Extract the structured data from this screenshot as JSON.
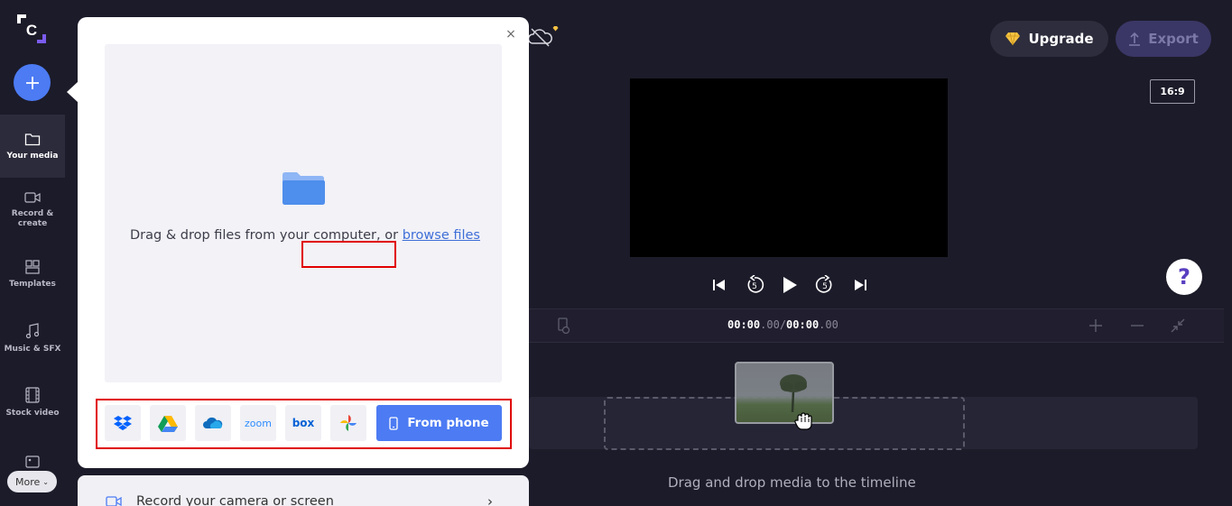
{
  "rail": {
    "items": [
      {
        "label": "Your media",
        "icon": "folder-icon"
      },
      {
        "label": "Record & create",
        "icon": "camera-icon"
      },
      {
        "label": "Templates",
        "icon": "templates-icon"
      },
      {
        "label": "Music & SFX",
        "icon": "music-icon"
      },
      {
        "label": "Stock video",
        "icon": "film-icon"
      }
    ],
    "more_label": "More"
  },
  "topbar": {
    "upgrade_label": "Upgrade",
    "export_label": "Export"
  },
  "preview": {
    "aspect_ratio": "16:9"
  },
  "timeline": {
    "current_time": "00:00",
    "current_frac": ".00",
    "separator": "/",
    "total_time": "00:00",
    "total_frac": ".00",
    "hint": "Drag and drop media to the timeline"
  },
  "popup": {
    "drop_text": "Drag & drop files from your computer, or ",
    "browse_link": "browse files",
    "sources": [
      {
        "name": "dropbox",
        "label": ""
      },
      {
        "name": "google-drive",
        "label": ""
      },
      {
        "name": "onedrive",
        "label": ""
      },
      {
        "name": "zoom",
        "label": "zoom"
      },
      {
        "name": "box",
        "label": "box"
      },
      {
        "name": "google-photos",
        "label": ""
      }
    ],
    "from_phone_label": "From phone",
    "record_label": "Record your camera or screen"
  },
  "colors": {
    "accent": "#4c7bf3",
    "highlight": "#e00000",
    "background": "#1c1b29"
  }
}
